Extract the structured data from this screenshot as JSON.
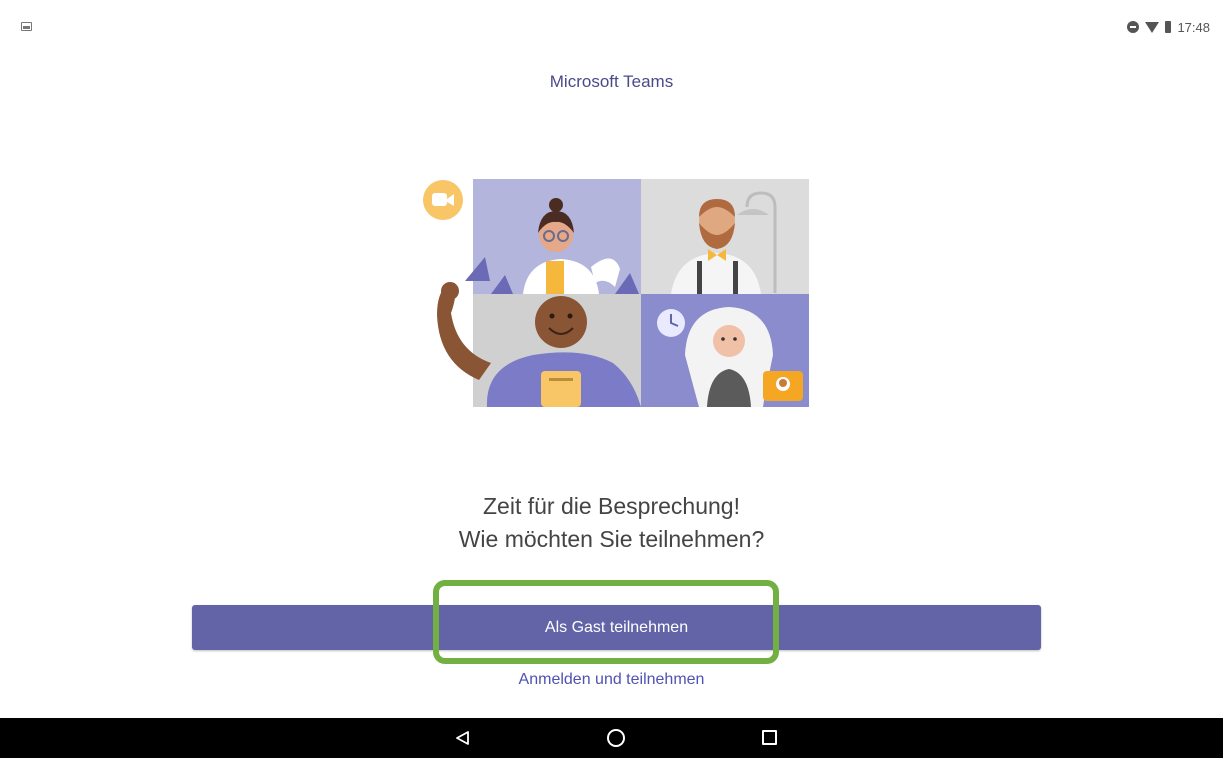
{
  "status_bar": {
    "time": "17:48",
    "icons": [
      "image-notification-icon",
      "do-not-disturb-icon",
      "wifi-icon",
      "battery-icon"
    ]
  },
  "app": {
    "title": "Microsoft Teams"
  },
  "illustration": {
    "icons": [
      "video-camera-icon",
      "clock-icon"
    ]
  },
  "heading": {
    "line1": "Zeit für die Besprechung!",
    "line2": "Wie möchten Sie teilnehmen?"
  },
  "actions": {
    "guest_label": "Als Gast teilnehmen",
    "signin_label": "Anmelden und teilnehmen"
  },
  "colors": {
    "primary": "#6264a7",
    "link": "#4f52b2",
    "highlight": "#72b043",
    "title": "#4a4a8a"
  },
  "nav_bar": {
    "icons": [
      "back-icon",
      "home-icon",
      "recents-icon"
    ]
  }
}
